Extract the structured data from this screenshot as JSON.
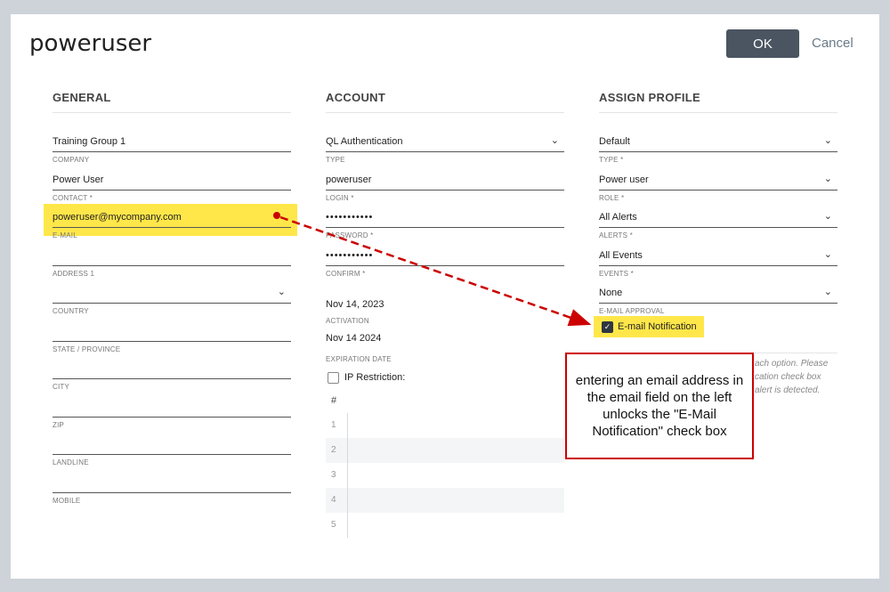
{
  "dialog": {
    "title": "poweruser",
    "ok_label": "OK",
    "cancel_label": "Cancel"
  },
  "general": {
    "heading": "GENERAL",
    "company": {
      "value": "Training Group 1",
      "label": "COMPANY"
    },
    "contact": {
      "value": "Power User",
      "label": "CONTACT *"
    },
    "email": {
      "value": "poweruser@mycompany.com",
      "label": "E-MAIL"
    },
    "address1": {
      "value": "",
      "label": "ADDRESS 1"
    },
    "country": {
      "value": "",
      "label": "COUNTRY"
    },
    "state": {
      "value": "",
      "label": "STATE / PROVINCE"
    },
    "city": {
      "value": "",
      "label": "CITY"
    },
    "zip": {
      "value": "",
      "label": "ZIP"
    },
    "landline": {
      "value": "",
      "label": "LANDLINE"
    },
    "mobile": {
      "value": "",
      "label": "MOBILE"
    }
  },
  "account": {
    "heading": "ACCOUNT",
    "type": {
      "value": "QL Authentication",
      "label": "TYPE"
    },
    "login": {
      "value": "poweruser",
      "label": "LOGIN *"
    },
    "password": {
      "value": "•••••••••••",
      "label": "PASSWORD *"
    },
    "confirm": {
      "value": "•••••••••••",
      "label": "CONFIRM *"
    },
    "activation": {
      "value": "Nov 14, 2023",
      "label": "ACTIVATION"
    },
    "expiration": {
      "value": "Nov 14 2024",
      "label": "EXPIRATION DATE"
    },
    "ip_restriction_label": "IP Restriction:",
    "grid_header": "#",
    "grid_rows": [
      "1",
      "2",
      "3",
      "4",
      "5"
    ]
  },
  "profile": {
    "heading": "ASSIGN PROFILE",
    "type": {
      "value": "Default",
      "label": "TYPE *"
    },
    "role": {
      "value": "Power user",
      "label": "ROLE *"
    },
    "alerts": {
      "value": "All Alerts",
      "label": "ALERTS *"
    },
    "events": {
      "value": "All Events",
      "label": "EVENTS *"
    },
    "email_approval": {
      "value": "None",
      "label": "E-MAIL APPROVAL"
    },
    "email_notification_label": "E-mail Notification",
    "hint_lines": [
      "ach option. Please",
      "cation check box",
      "alert is detected."
    ]
  },
  "annotation": {
    "text": "entering an email address in the email field on the left unlocks the \"E-Mail Notification\" check box",
    "color": "#cc0000"
  },
  "colors": {
    "ok_button": "#4a5561",
    "highlight": "#ffe74a"
  }
}
